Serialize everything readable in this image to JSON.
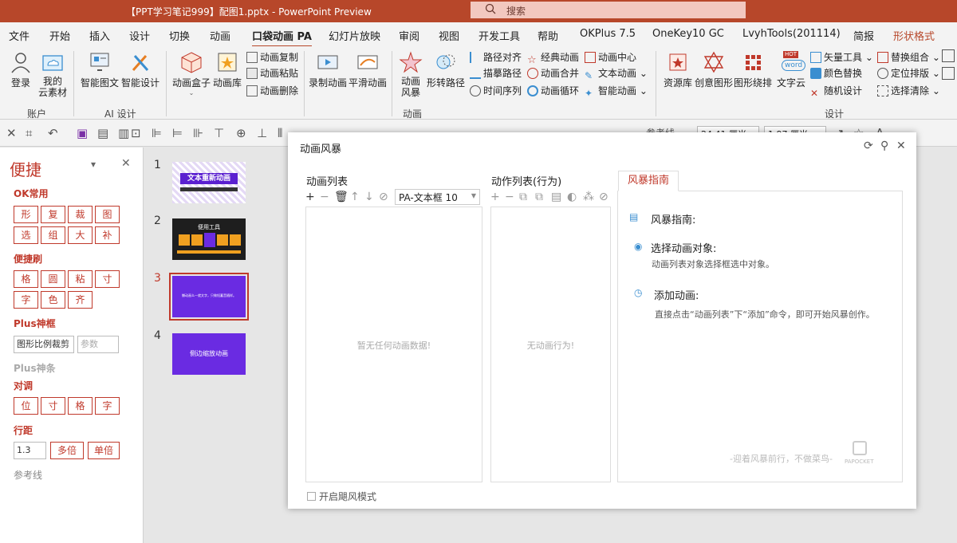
{
  "window": {
    "title": "【PPT学习笔记999】配图1.pptx - PowerPoint Preview",
    "search_placeholder": "搜索"
  },
  "menu": [
    "文件",
    "开始",
    "插入",
    "设计",
    "切换",
    "动画",
    "口袋动画 PA",
    "幻灯片放映",
    "审阅",
    "视图",
    "开发工具",
    "帮助",
    "OKPlus 7.5",
    "OneKey10 GC",
    "LvyhTools(201114)",
    "简报",
    "形状格式"
  ],
  "ribbon": {
    "login": "登录",
    "cloud": "我的\n云素材",
    "group_account": "账户",
    "smart_pic": "智能图文",
    "smart_design": "智能设计",
    "group_ai": "AI 设计",
    "anim_box": "动画盒子",
    "anim_lib": "动画库",
    "anim_copy": "动画复制",
    "anim_paste": "动画粘贴",
    "anim_delete": "动画删除",
    "record": "录制动画",
    "smooth": "平滑动画",
    "storm_l1": "动画",
    "storm_l2": "风暴",
    "shape_path": "形转路径",
    "path_align": "路径对齐",
    "trace_path": "描摹路径",
    "time_seq": "时间序列",
    "classic": "经典动画",
    "merge": "动画合并",
    "loop": "动画循环",
    "center": "动画中心",
    "text_anim": "文本动画",
    "smart_anim": "智能动画",
    "group_anim": "动画",
    "resources": "资源库",
    "creative": "创意图形",
    "layout": "图形绕排",
    "wordcloud": "文字云",
    "vector": "矢量工具",
    "color_replace": "颜色替换",
    "random": "随机设计",
    "replace_combo": "替换组合",
    "position_layout": "定位排版",
    "select_clear": "选择清除",
    "group_design": "设计",
    "hot_badge": "HOT",
    "word_badge": "word"
  },
  "qat": {
    "reference_line": "参考线",
    "width_value": "24.41 厘米",
    "height_value": "1.97 厘米"
  },
  "left_panel": {
    "title": "便捷",
    "ok_common": "OK常用",
    "ok_buttons": [
      "形",
      "复",
      "裁",
      "图",
      "选",
      "组",
      "大",
      "补"
    ],
    "quick_brush": "便捷刷",
    "brush_buttons": [
      "格",
      "圆",
      "粘",
      "寸",
      "字",
      "色",
      "齐"
    ],
    "plus_frame": "Plus神框",
    "crop_label": "图形比例裁剪",
    "param_placeholder": "参数",
    "plus_bar": "Plus神条",
    "align": "对调",
    "align_buttons": [
      "位",
      "寸",
      "格",
      "字"
    ],
    "line_spacing": "行距",
    "spacing_value": "1.3",
    "multi": "多倍",
    "single": "单倍",
    "guides": "参考线"
  },
  "thumbnails": [
    {
      "num": "1",
      "title": "文本重新动画",
      "selected": false
    },
    {
      "num": "2",
      "title": "便用工具",
      "selected": false
    },
    {
      "num": "3",
      "title": "懒动画么一就文字，只做短蓄音随样。",
      "selected": true
    },
    {
      "num": "4",
      "title": "侧边缩放动画",
      "selected": false
    }
  ],
  "dialog": {
    "title": "动画风暴",
    "anim_list_header": "动画列表",
    "action_list_header": "动作列表(行为)",
    "selector_value": "PA-文本框 10",
    "anim_empty": "暂无任何动画数据!",
    "action_empty": "无动画行为!",
    "tab_label": "风暴指南",
    "guide_title": "风暴指南:",
    "step1_title": "选择动画对象:",
    "step1_desc": "动画列表对象选择框选中对象。",
    "step2_title": "添加动画:",
    "step2_desc": "直接点击“动画列表”下“添加”命令，即可开始风暴创作。",
    "slogan": "-迎着风暴前行，不做菜鸟-",
    "brand": "PAPOCKET",
    "typhoon_mode": "开启飓风模式"
  },
  "colors": {
    "accent": "#b7472a",
    "panel_red": "#c0392b",
    "slide_purple": "#6a2be2"
  }
}
